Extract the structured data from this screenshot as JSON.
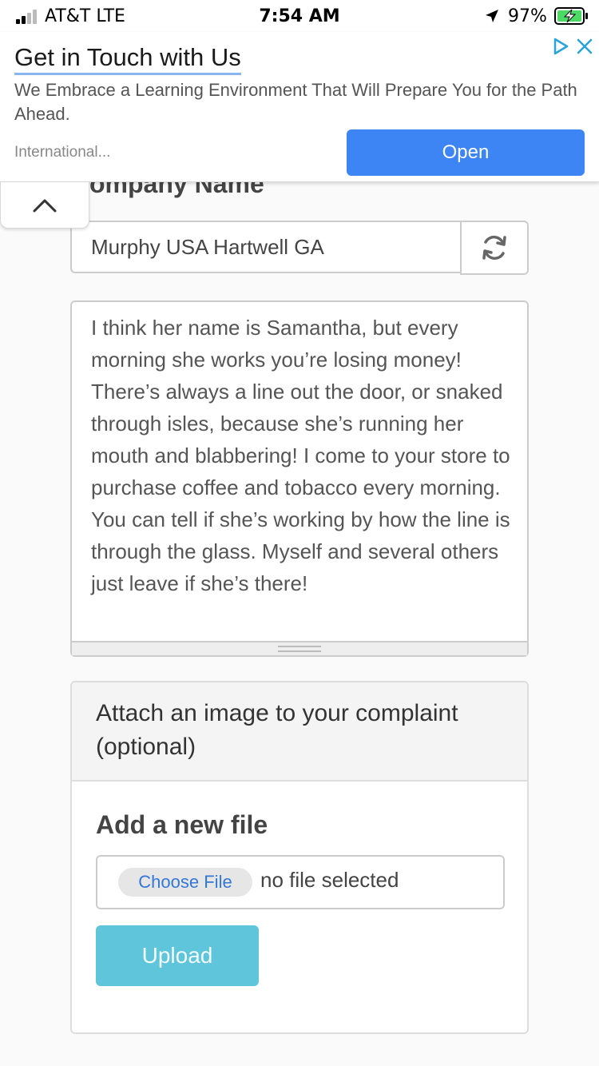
{
  "status_bar": {
    "carrier": "AT&T  LTE",
    "time": "7:54 AM",
    "battery_percent": "97%"
  },
  "ad": {
    "title": "Get in Touch with Us",
    "body": "We Embrace a Learning Environment That Will Prepare You for the Path Ahead.",
    "source": "International...",
    "open_label": "Open"
  },
  "form": {
    "company_label": "ompany Name",
    "company_value": "Murphy USA Hartwell GA",
    "complaint_text": "I think her name is Samantha, but every morning she works you’re losing money! There’s always a line out the door, or snaked through isles, because she’s running her mouth and blabbering! I come to your store to purchase coffee and tobacco every morning. You can tell if she’s working by how the line is through the glass. Myself and several others just leave if she’s there!"
  },
  "attach": {
    "title": "Attach an image to your complaint (optional)",
    "add_file_title": "Add a new file",
    "choose_file_label": "Choose File",
    "no_file_text": "no file selected",
    "upload_label": "Upload"
  },
  "colors": {
    "open_button": "#3d84f5",
    "upload_button": "#5ec5da",
    "choose_file_text": "#3478d6",
    "battery_charging": "#4cd964"
  },
  "icons": [
    "signal-icon",
    "location-arrow-icon",
    "battery-charging-icon",
    "ad-choices-icon",
    "close-icon",
    "chevron-up-icon",
    "refresh-icon"
  ]
}
